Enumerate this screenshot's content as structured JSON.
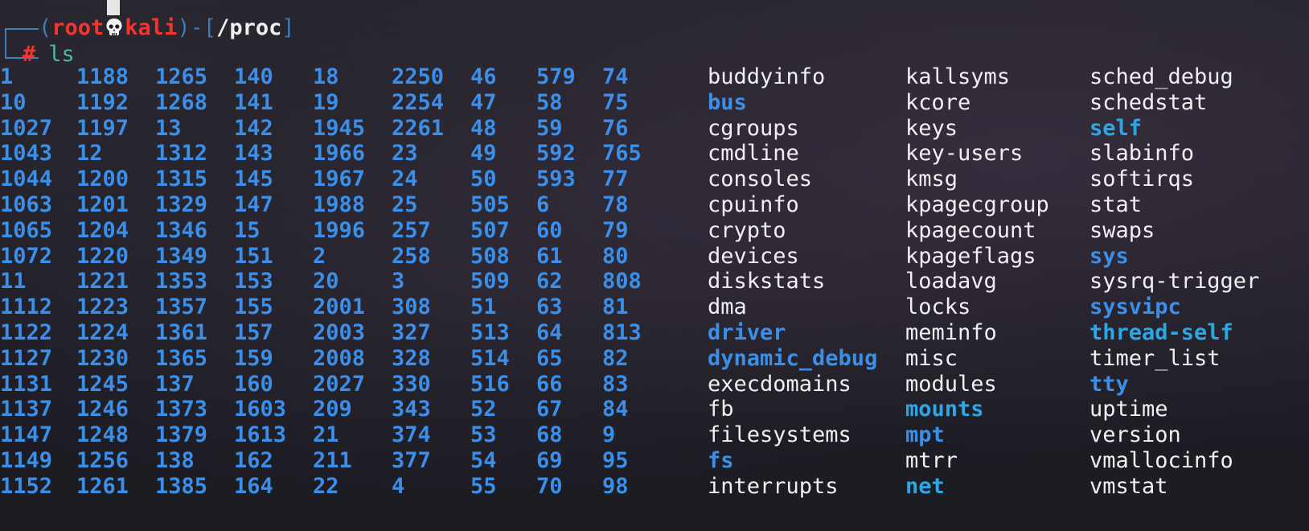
{
  "prompt": {
    "open_paren": "(",
    "user": "root",
    "host": "kali",
    "close_paren": ")-[",
    "cwd": "/proc",
    "close_bracket": "]",
    "hash": "#",
    "command": "ls"
  },
  "numeric_columns": [
    [
      "1",
      "10",
      "1027",
      "1043",
      "1044",
      "1063",
      "1065",
      "1072",
      "11",
      "1112",
      "1122",
      "1127",
      "1131",
      "1137",
      "1147",
      "1149",
      "1152"
    ],
    [
      "1188",
      "1192",
      "1197",
      "12",
      "1200",
      "1201",
      "1204",
      "1220",
      "1221",
      "1223",
      "1224",
      "1230",
      "1245",
      "1246",
      "1248",
      "1256",
      "1261"
    ],
    [
      "1265",
      "1268",
      "13",
      "1312",
      "1315",
      "1329",
      "1346",
      "1349",
      "1353",
      "1357",
      "1361",
      "1365",
      "137",
      "1373",
      "1379",
      "138",
      "1385"
    ],
    [
      "140",
      "141",
      "142",
      "143",
      "145",
      "147",
      "15",
      "151",
      "153",
      "155",
      "157",
      "159",
      "160",
      "1603",
      "1613",
      "162",
      "164"
    ],
    [
      "18",
      "19",
      "1945",
      "1966",
      "1967",
      "1988",
      "1996",
      "2",
      "20",
      "2001",
      "2003",
      "2008",
      "2027",
      "209",
      "21",
      "211",
      "22"
    ],
    [
      "2250",
      "2254",
      "2261",
      "23",
      "24",
      "25",
      "257",
      "258",
      "3",
      "308",
      "327",
      "328",
      "330",
      "343",
      "374",
      "377",
      "4"
    ],
    [
      "46",
      "47",
      "48",
      "49",
      "50",
      "505",
      "507",
      "508",
      "509",
      "51",
      "513",
      "514",
      "516",
      "52",
      "53",
      "54",
      "55"
    ],
    [
      "579",
      "58",
      "59",
      "592",
      "593",
      "6",
      "60",
      "61",
      "62",
      "63",
      "64",
      "65",
      "66",
      "67",
      "68",
      "69",
      "70"
    ],
    [
      "74",
      "75",
      "76",
      "765",
      "77",
      "78",
      "79",
      "80",
      "808",
      "81",
      "813",
      "82",
      "83",
      "84",
      "9",
      "95",
      "98"
    ]
  ],
  "name_columns": [
    [
      {
        "name": "buddyinfo",
        "type": "file"
      },
      {
        "name": "bus",
        "type": "dir"
      },
      {
        "name": "cgroups",
        "type": "file"
      },
      {
        "name": "cmdline",
        "type": "file"
      },
      {
        "name": "consoles",
        "type": "file"
      },
      {
        "name": "cpuinfo",
        "type": "file"
      },
      {
        "name": "crypto",
        "type": "file"
      },
      {
        "name": "devices",
        "type": "file"
      },
      {
        "name": "diskstats",
        "type": "file"
      },
      {
        "name": "dma",
        "type": "file"
      },
      {
        "name": "driver",
        "type": "dir"
      },
      {
        "name": "dynamic_debug",
        "type": "dir"
      },
      {
        "name": "execdomains",
        "type": "file"
      },
      {
        "name": "fb",
        "type": "file"
      },
      {
        "name": "filesystems",
        "type": "file"
      },
      {
        "name": "fs",
        "type": "dir"
      },
      {
        "name": "interrupts",
        "type": "file"
      }
    ],
    [
      {
        "name": "kallsyms",
        "type": "file"
      },
      {
        "name": "kcore",
        "type": "file"
      },
      {
        "name": "keys",
        "type": "file"
      },
      {
        "name": "key-users",
        "type": "file"
      },
      {
        "name": "kmsg",
        "type": "file"
      },
      {
        "name": "kpagecgroup",
        "type": "file"
      },
      {
        "name": "kpagecount",
        "type": "file"
      },
      {
        "name": "kpageflags",
        "type": "file"
      },
      {
        "name": "loadavg",
        "type": "file"
      },
      {
        "name": "locks",
        "type": "file"
      },
      {
        "name": "meminfo",
        "type": "file"
      },
      {
        "name": "misc",
        "type": "file"
      },
      {
        "name": "modules",
        "type": "file"
      },
      {
        "name": "mounts",
        "type": "link"
      },
      {
        "name": "mpt",
        "type": "dir"
      },
      {
        "name": "mtrr",
        "type": "file"
      },
      {
        "name": "net",
        "type": "link"
      }
    ],
    [
      {
        "name": "sched_debug",
        "type": "file"
      },
      {
        "name": "schedstat",
        "type": "file"
      },
      {
        "name": "self",
        "type": "link"
      },
      {
        "name": "slabinfo",
        "type": "file"
      },
      {
        "name": "softirqs",
        "type": "file"
      },
      {
        "name": "stat",
        "type": "file"
      },
      {
        "name": "swaps",
        "type": "file"
      },
      {
        "name": "sys",
        "type": "dir"
      },
      {
        "name": "sysrq-trigger",
        "type": "file"
      },
      {
        "name": "sysvipc",
        "type": "dir"
      },
      {
        "name": "thread-self",
        "type": "link"
      },
      {
        "name": "timer_list",
        "type": "file"
      },
      {
        "name": "tty",
        "type": "dir"
      },
      {
        "name": "uptime",
        "type": "file"
      },
      {
        "name": "version",
        "type": "file"
      },
      {
        "name": "vmallocinfo",
        "type": "file"
      },
      {
        "name": "vmstat",
        "type": "file"
      }
    ]
  ],
  "colors": {
    "directory": "#3b8fe8",
    "link": "#2ba7e6",
    "file": "#f0f0f0",
    "prompt_red": "#f2352e",
    "prompt_frame": "#3a7dbd",
    "command": "#4dbaa4"
  },
  "icons": {
    "prompt_separator": "skull-icon"
  }
}
